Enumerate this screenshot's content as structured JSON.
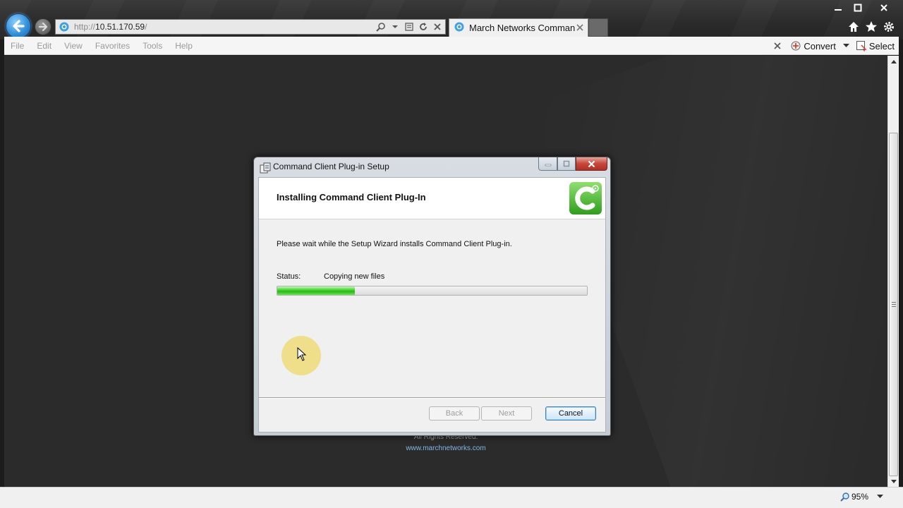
{
  "browser": {
    "address": {
      "prefix": "http://",
      "host": "10.51.170.59",
      "suffix": "/"
    },
    "tab": {
      "label": "March Networks Comman..."
    },
    "menu": [
      "File",
      "Edit",
      "View",
      "Favorites",
      "Tools",
      "Help"
    ],
    "toolbar": {
      "convert_label": "Convert",
      "select_label": "Select"
    },
    "zoom_label": "95%"
  },
  "page": {
    "footer_rights": "All Rights Reserved.",
    "footer_link": "www.marchnetworks.com"
  },
  "dialog": {
    "title": "Command Client Plug-in Setup",
    "heading": "Installing Command Client Plug-In",
    "description": "Please wait while the Setup Wizard installs Command Client Plug-in.",
    "status_label": "Status:",
    "status_value": "Copying new files",
    "progress": 0.25,
    "buttons": {
      "back": "Back",
      "next": "Next",
      "cancel": "Cancel"
    },
    "logo_color": "#4bbf2e"
  },
  "colors": {
    "accent": "#2f8fd8",
    "progress_green": "#3fd02a",
    "page_bg": "#2b2b2b"
  },
  "icons": {
    "back": "back-arrow-icon",
    "forward": "forward-arrow-icon",
    "home": "home-icon",
    "favorites": "star-icon",
    "settings": "gear-icon",
    "zoom": "magnifier-icon"
  }
}
